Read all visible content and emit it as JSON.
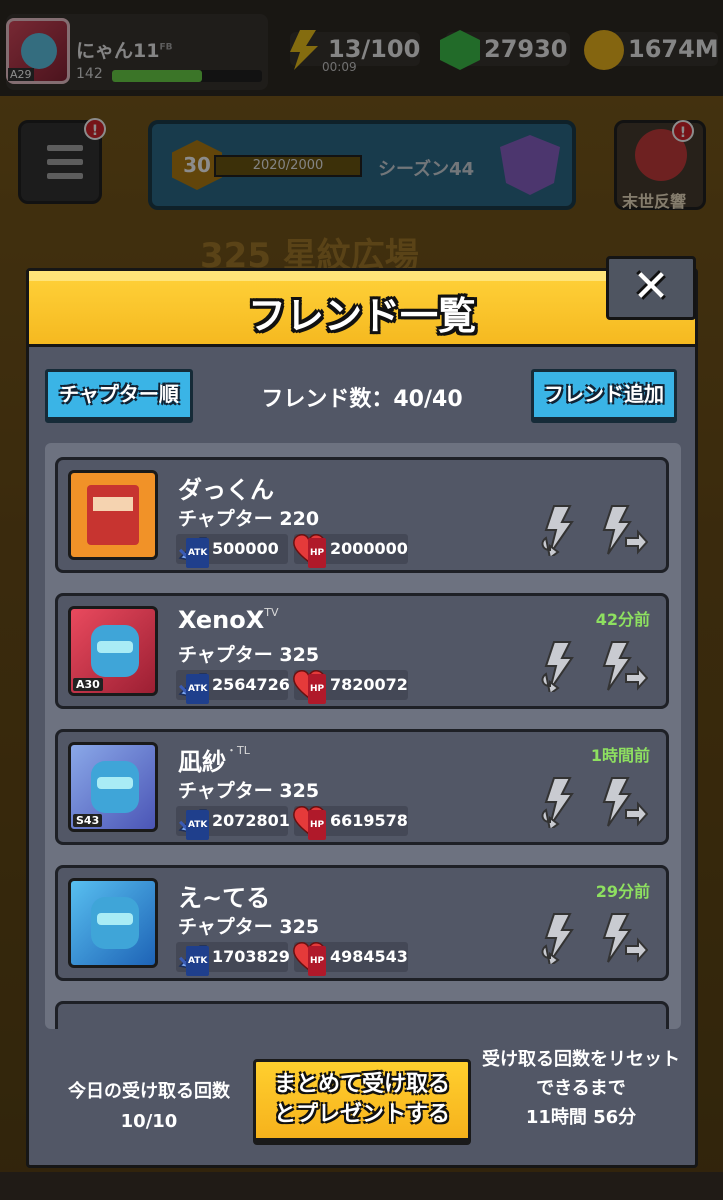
{
  "player": {
    "name": "にゃん11",
    "name_suffix": "FB",
    "avatar_tag": "A29",
    "xp_number": "142",
    "xp_fraction": 0.6
  },
  "resources": {
    "energy": "13/100",
    "energy_timer": "00:09",
    "gems": "27930",
    "coins": "1674M"
  },
  "season": {
    "level": "30",
    "progress_text": "2020/2000",
    "name": "シーズン44"
  },
  "event": {
    "label": "末世反響"
  },
  "stage": {
    "title": "325 星紋広場"
  },
  "modal": {
    "title": "フレンド一覧",
    "close_label": "✕",
    "sort_button": "チャプター順",
    "friend_count": "フレンド数：40/40",
    "add_button": "フレンド追加"
  },
  "friends": [
    {
      "name": "ダっくん",
      "name_suffix": "",
      "chapter": "チャプター 220",
      "atk": "500000",
      "hp": "2000000",
      "time_ago": "",
      "avatar_tag": ""
    },
    {
      "name": "XenoX",
      "name_suffix": "TV",
      "chapter": "チャプター 325",
      "atk": "2564726",
      "hp": "7820072",
      "time_ago": "42分前",
      "avatar_tag": "A30"
    },
    {
      "name": "凪紗",
      "name_suffix": "・TL",
      "chapter": "チャプター 325",
      "atk": "2072801",
      "hp": "6619578",
      "time_ago": "1時間前",
      "avatar_tag": "S43"
    },
    {
      "name": "え~てる",
      "name_suffix": "",
      "chapter": "チャプター 325",
      "atk": "1703829",
      "hp": "4984543",
      "time_ago": "29分前",
      "avatar_tag": ""
    }
  ],
  "stat_labels": {
    "atk": "ATK",
    "hp": "HP"
  },
  "footer": {
    "receive_label_line1": "今日の受け取る回数",
    "receive_count": "10/10",
    "collect_button_line1": "まとめて受け取る",
    "collect_button_line2": "とプレゼントする",
    "reset_line1": "受け取る回数をリセット",
    "reset_line2": "できるまで",
    "reset_time": "11時間 56分"
  },
  "colors": {
    "header_yellow": "#f5b920",
    "button_blue": "#3ab4e6",
    "time_green": "#8ee060",
    "panel_gray": "#525766"
  }
}
